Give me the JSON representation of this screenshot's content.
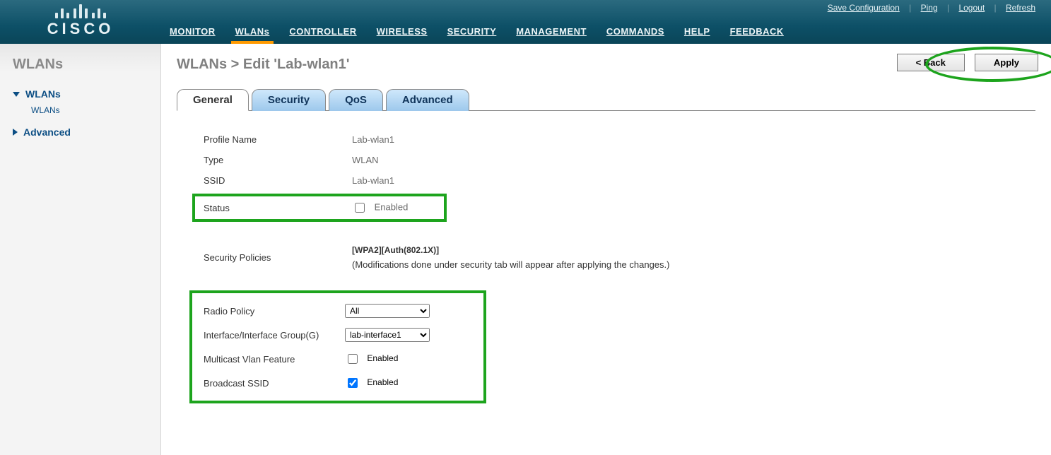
{
  "brand": "CISCO",
  "toplinks": {
    "save": "Save Configuration",
    "ping": "Ping",
    "logout": "Logout",
    "refresh": "Refresh"
  },
  "mainnav": {
    "monitor": "MONITOR",
    "wlans": "WLANs",
    "controller": "CONTROLLER",
    "wireless": "WIRELESS",
    "security": "SECURITY",
    "management": "MANAGEMENT",
    "commands": "COMMANDS",
    "help": "HELP",
    "feedback": "FEEDBACK"
  },
  "sidebar": {
    "title": "WLANs",
    "wlans": "WLANs",
    "wlans_sub": "WLANs",
    "advanced": "Advanced"
  },
  "breadcrumb": "WLANs > Edit   'Lab-wlan1'",
  "buttons": {
    "back": "< Back",
    "apply": "Apply"
  },
  "tabs": {
    "general": "General",
    "security": "Security",
    "qos": "QoS",
    "advanced": "Advanced"
  },
  "form": {
    "profile_name_label": "Profile Name",
    "profile_name_value": "Lab-wlan1",
    "type_label": "Type",
    "type_value": "WLAN",
    "ssid_label": "SSID",
    "ssid_value": "Lab-wlan1",
    "status_label": "Status",
    "status_enabled": "Enabled",
    "status_checked": false,
    "sec_policies_label": "Security Policies",
    "sec_policies_value": "[WPA2][Auth(802.1X)]",
    "sec_note": "(Modifications done under security tab will appear after applying the changes.)",
    "radio_policy_label": "Radio Policy",
    "radio_policy_value": "All",
    "interface_label": "Interface/Interface Group(G)",
    "interface_value": "lab-interface1",
    "multicast_label": "Multicast Vlan Feature",
    "multicast_enabled": "Enabled",
    "multicast_checked": false,
    "broadcast_label": "Broadcast SSID",
    "broadcast_enabled": "Enabled",
    "broadcast_checked": true
  }
}
